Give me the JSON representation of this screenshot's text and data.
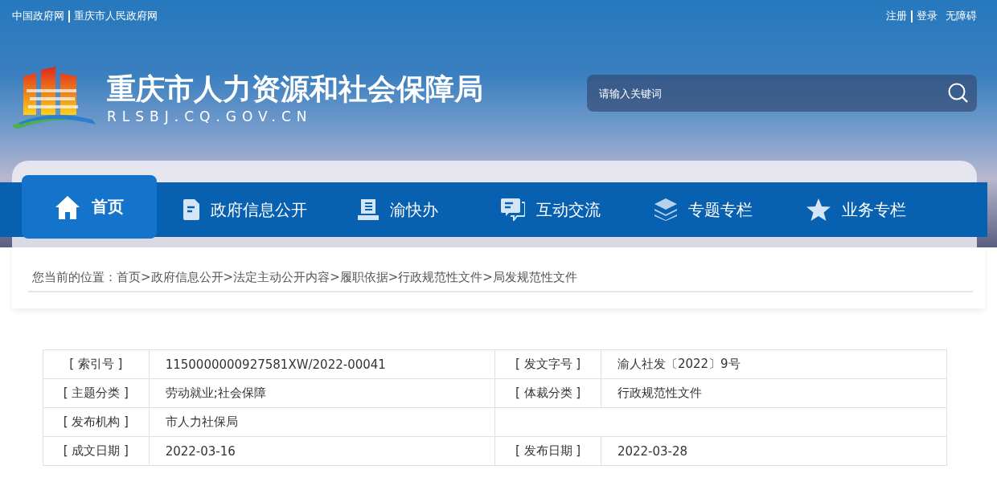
{
  "top_links": {
    "left": [
      {
        "label": "中国政府网"
      },
      {
        "label": "重庆市人民政府网"
      }
    ],
    "right": [
      {
        "label": "注册"
      },
      {
        "label": "登录"
      },
      {
        "label": "无障碍"
      }
    ]
  },
  "site": {
    "title": "重庆市人力资源和社会保障局",
    "domain": "RLSBJ.CQ.GOV.CN"
  },
  "search": {
    "placeholder": "请输入关键词"
  },
  "nav": [
    {
      "label": "首页",
      "kind": "home",
      "selected": true
    },
    {
      "label": "政府信息公开",
      "kind": "doc",
      "selected": false
    },
    {
      "label": "渝快办",
      "kind": "book",
      "selected": false
    },
    {
      "label": "互动交流",
      "kind": "chat",
      "selected": false
    },
    {
      "label": "专题专栏",
      "kind": "layers",
      "selected": false
    },
    {
      "label": "业务专栏",
      "kind": "star",
      "selected": false
    }
  ],
  "breadcrumb": {
    "prefix": "您当前的位置：",
    "items": [
      {
        "label": "首页"
      },
      {
        "sep": ">",
        "label": "政府信息公开"
      },
      {
        "sep": ">",
        "label": "法定主动公开内容"
      },
      {
        "sep": ">",
        "label": "履职依据"
      },
      {
        "sep": ">",
        "label": "行政规范性文件"
      },
      {
        "sep": ">",
        "label": "局发规范性文件"
      }
    ]
  },
  "info_table": {
    "rows": [
      {
        "cells": [
          "[ 索引号 ]",
          "1150000000927581XW/2022-00041",
          "[ 发文字号 ]",
          "渝人社发〔2022〕9号"
        ]
      },
      {
        "cells": [
          "[ 主题分类 ]",
          "劳动就业;社会保障",
          "[ 体裁分类 ]",
          "行政规范性文件"
        ]
      },
      {
        "cells": [
          "[ 发布机构 ]",
          "市人力社保局"
        ]
      },
      {
        "cells": [
          "[ 成文日期 ]",
          "2022-03-16",
          "[ 发布日期 ]",
          "2022-03-28"
        ]
      }
    ]
  }
}
